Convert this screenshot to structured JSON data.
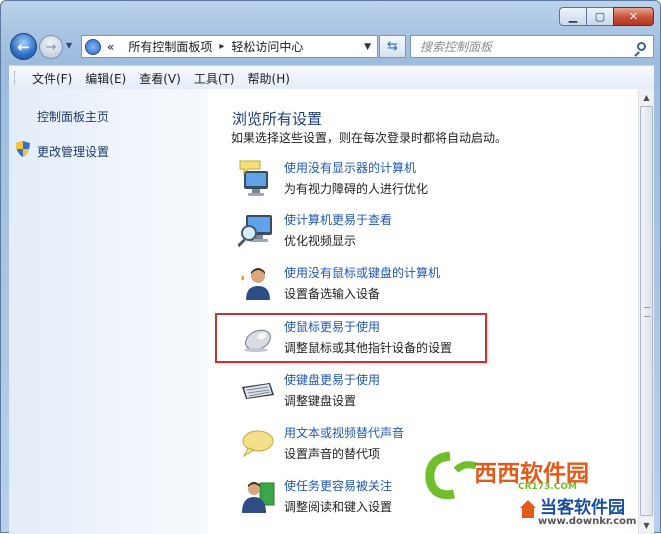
{
  "window": {
    "minimize_icon": "minimize-icon",
    "maximize_icon": "maximize-icon",
    "close_icon": "close-icon"
  },
  "address": {
    "overflow": "«",
    "crumbs": [
      "所有控制面板项",
      "轻松访问中心"
    ]
  },
  "search": {
    "placeholder": "搜索控制面板"
  },
  "menu": [
    "文件(F)",
    "编辑(E)",
    "查看(V)",
    "工具(T)",
    "帮助(H)"
  ],
  "left": {
    "home": "控制面板主页",
    "admin": "更改管理设置"
  },
  "main": {
    "heading": "浏览所有设置",
    "description": "如果选择这些设置，则在每次登录时都将自动启动。",
    "items": [
      {
        "title": "使用没有显示器的计算机",
        "sub": "为有视力障碍的人进行优化",
        "icon": "narrator-display-icon"
      },
      {
        "title": "使计算机更易于查看",
        "sub": "优化视频显示",
        "icon": "magnifier-display-icon"
      },
      {
        "title": "使用没有鼠标或键盘的计算机",
        "sub": "设置备选输入设备",
        "icon": "user-speech-icon"
      },
      {
        "title": "使鼠标更易于使用",
        "sub": "调整鼠标或其他指针设备的设置",
        "icon": "mouse-icon"
      },
      {
        "title": "使键盘更易于使用",
        "sub": "调整键盘设置",
        "icon": "keyboard-icon"
      },
      {
        "title": "用文本或视频替代声音",
        "sub": "设置声音的替代项",
        "icon": "speech-bubble-icon"
      },
      {
        "title": "使任务更容易被关注",
        "sub": "调整阅读和键入设置",
        "icon": "user-book-icon"
      }
    ]
  },
  "watermark": {
    "brand": "西西软件园",
    "domain1": "CR173.COM",
    "brand2": "当客软件园",
    "domain2": "www.downkr.com"
  },
  "colors": {
    "link": "#1f57b3",
    "heading": "#1e3f78",
    "highlight": "#b53a3a"
  }
}
